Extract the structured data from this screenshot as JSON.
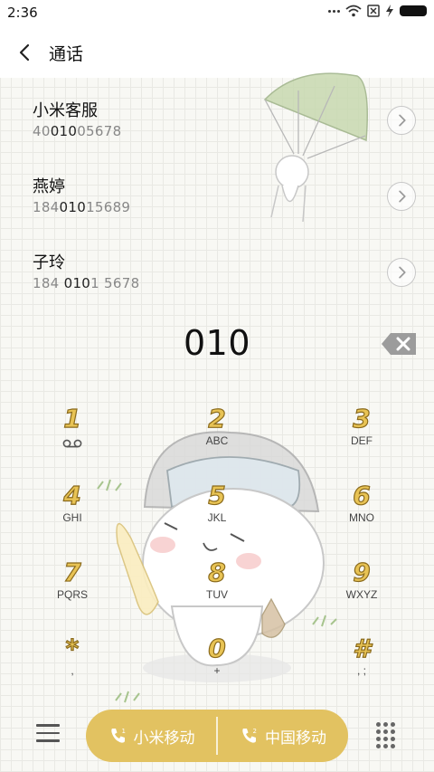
{
  "status_bar": {
    "time": "2:36"
  },
  "header": {
    "title": "通话"
  },
  "contacts": [
    {
      "name": "小米客服",
      "number_pre": "40",
      "number_match": "010",
      "number_post": "05678"
    },
    {
      "name": "燕婷",
      "number_pre": "184",
      "number_match": "010",
      "number_post": "15689"
    },
    {
      "name": "子玲",
      "number_pre": "184 ",
      "number_match": "010",
      "number_post": "1 5678"
    }
  ],
  "dialed_number": "010",
  "keypad": [
    {
      "digit": "1",
      "letters": ""
    },
    {
      "digit": "2",
      "letters": "ABC"
    },
    {
      "digit": "3",
      "letters": "DEF"
    },
    {
      "digit": "4",
      "letters": "GHI"
    },
    {
      "digit": "5",
      "letters": "JKL"
    },
    {
      "digit": "6",
      "letters": "MNO"
    },
    {
      "digit": "7",
      "letters": "PQRS"
    },
    {
      "digit": "8",
      "letters": "TUV"
    },
    {
      "digit": "9",
      "letters": "WXYZ"
    },
    {
      "digit": "*",
      "letters": ","
    },
    {
      "digit": "0",
      "letters": "+"
    },
    {
      "digit": "#",
      "letters": ", ;"
    }
  ],
  "call_buttons": [
    {
      "sim": "1",
      "label": "小米移动"
    },
    {
      "sim": "2",
      "label": "中国移动"
    }
  ],
  "icons": {
    "back": "back-arrow-icon",
    "backspace": "backspace-icon",
    "menu": "menu-icon",
    "dialpad": "dialpad-grid-icon",
    "voicemail": "voicemail-icon",
    "chevron": "chevron-right-icon",
    "phone": "phone-icon"
  },
  "colors": {
    "accent": "#e2c261",
    "digit_fill": "#e8c354",
    "background": "#f8f8f4"
  }
}
